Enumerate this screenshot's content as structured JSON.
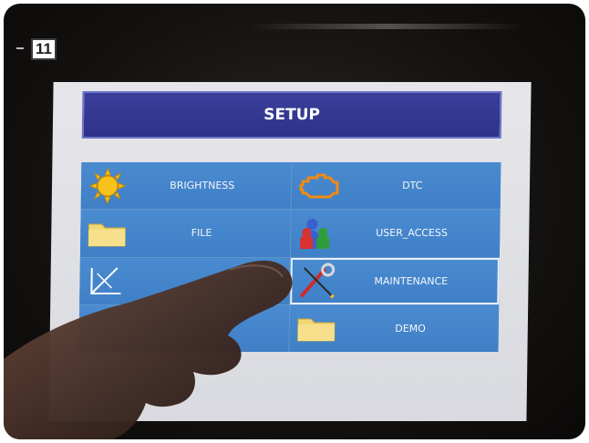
{
  "step_badge": "11",
  "setup": {
    "title": "SETUP"
  },
  "menu": {
    "items": [
      {
        "label": "BRIGHTNESS",
        "icon": "sun-icon"
      },
      {
        "label": "DTC",
        "icon": "engine-icon"
      },
      {
        "label": "FILE",
        "icon": "folder-icon"
      },
      {
        "label": "USER_ACCESS",
        "icon": "users-icon"
      },
      {
        "label": "",
        "icon": "calibration-icon"
      },
      {
        "label": "MAINTENANCE",
        "icon": "tools-icon",
        "selected": true
      },
      {
        "label": "",
        "icon": "hidden-item-icon"
      },
      {
        "label": "DEMO",
        "icon": "folder-icon"
      }
    ]
  },
  "colors": {
    "title_bar": "#2e3289",
    "tile": "#4a8bd0",
    "screen_bg": "#e6e6ea"
  }
}
